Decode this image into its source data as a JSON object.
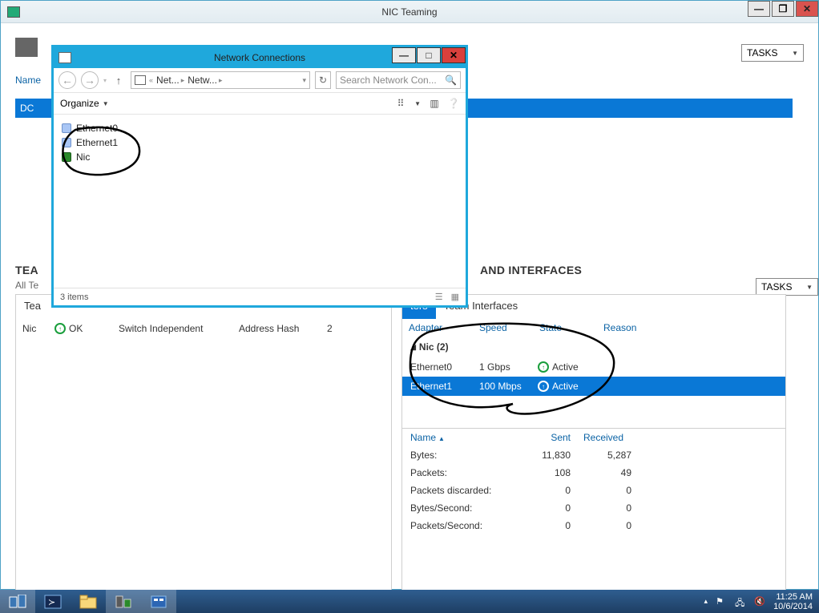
{
  "main_window": {
    "title": "NIC Teaming"
  },
  "upper": {
    "name_header": "Name",
    "dc_row": "DC",
    "tasks": "TASKS"
  },
  "mid": {
    "team": "TEA",
    "all": "All Te",
    "and": "AND INTERFACES",
    "tasks": "TASKS"
  },
  "left_pane": {
    "tab": "Tea",
    "row": {
      "name": "Nic",
      "status": "OK",
      "mode": "Switch Independent",
      "lb": "Address Hash",
      "count": "2"
    }
  },
  "right_pane": {
    "tabs": {
      "partial": "ters",
      "team_if": "Team Interfaces"
    },
    "headers": {
      "adapter": "Adapter",
      "speed": "Speed",
      "state": "State",
      "reason": "Reason"
    },
    "group": "Nic (2)",
    "rows": [
      {
        "adapter": "Ethernet0",
        "speed": "1 Gbps",
        "state": "Active"
      },
      {
        "adapter": "Ethernet1",
        "speed": "100 Mbps",
        "state": "Active"
      }
    ],
    "stats_headers": {
      "name": "Name",
      "sent": "Sent",
      "received": "Received"
    },
    "stats": [
      {
        "name": "Bytes:",
        "sent": "11,830",
        "recv": "5,287"
      },
      {
        "name": "Packets:",
        "sent": "108",
        "recv": "49"
      },
      {
        "name": "Packets discarded:",
        "sent": "0",
        "recv": "0"
      },
      {
        "name": "Bytes/Second:",
        "sent": "0",
        "recv": "0"
      },
      {
        "name": "Packets/Second:",
        "sent": "0",
        "recv": "0"
      }
    ]
  },
  "explorer": {
    "title": "Network Connections",
    "breadcrumb": {
      "seg1": "Net...",
      "seg2": "Netw..."
    },
    "search_placeholder": "Search Network Con...",
    "organize": "Organize",
    "items": [
      {
        "label": "Ethernet0"
      },
      {
        "label": "Ethernet1"
      },
      {
        "label": "Nic"
      }
    ],
    "status_count": "3 items"
  },
  "taskbar": {
    "time": "11:25 AM",
    "date": "10/6/2014"
  }
}
